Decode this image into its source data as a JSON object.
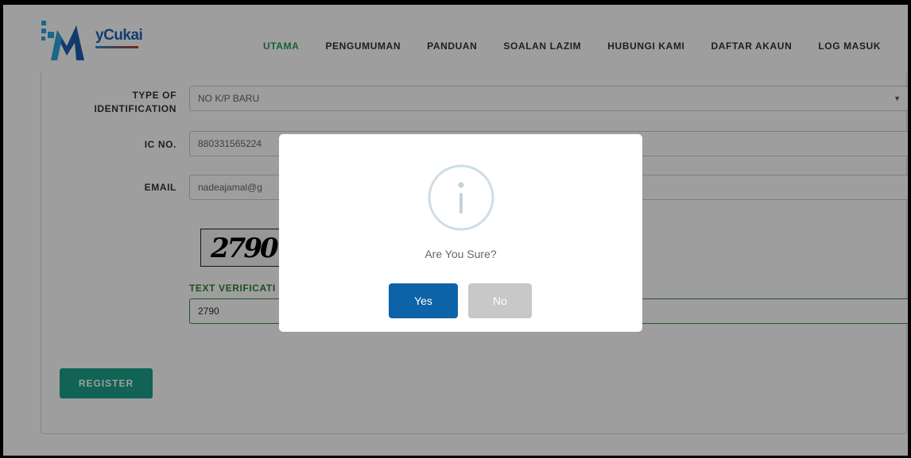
{
  "header": {
    "logo_text": "yCukai",
    "nav": [
      {
        "label": "UTAMA",
        "active": true
      },
      {
        "label": "PENGUMUMAN"
      },
      {
        "label": "PANDUAN"
      },
      {
        "label": "SOALAN LAZIM"
      },
      {
        "label": "HUBUNGI KAMI"
      },
      {
        "label": "DAFTAR AKAUN"
      },
      {
        "label": "LOG MASUK"
      }
    ]
  },
  "form": {
    "id_type_label_line1": "TYPE OF",
    "id_type_label_line2": "IDENTIFICATION",
    "id_type_value": "NO K/P BARU",
    "ic_label": "IC NO.",
    "ic_value": "880331565224",
    "email_label": "EMAIL",
    "email_value": "nadeajamal@g",
    "captcha_text": "2790",
    "text_verification_label": "TEXT VERIFICATI",
    "text_verification_value": "2790",
    "register_label": "REGISTER"
  },
  "modal": {
    "icon": "info-icon",
    "message": "Are You Sure?",
    "yes_label": "Yes",
    "no_label": "No"
  },
  "colors": {
    "nav_active": "#1ea05a",
    "register": "#1aa08a",
    "yes_button": "#0d63a8",
    "no_button": "#c8c8c8",
    "verification_label": "#2e7d32"
  }
}
